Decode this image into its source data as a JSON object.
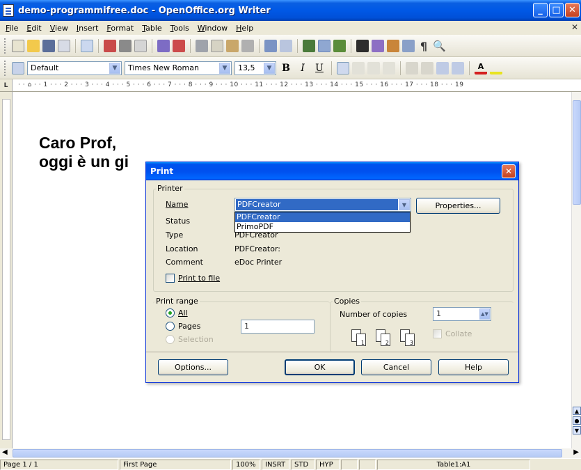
{
  "window": {
    "title": "demo-programmifree.doc - OpenOffice.org Writer"
  },
  "menu": [
    "File",
    "Edit",
    "View",
    "Insert",
    "Format",
    "Table",
    "Tools",
    "Window",
    "Help"
  ],
  "format_toolbar": {
    "style": "Default",
    "font": "Times New Roman",
    "size": "13,5"
  },
  "ruler": {
    "marks": "· · ⌂ · · 1 · · · 2 · · · 3 · · · 4 · · · 5 · · · 6 · · · 7 · · · 8 · · · 9 · · · 10 · · · 11 · · · 12 · · · 13 · · · 14 · · · 15 · · · 16 · · · 17 · · · 18 · · · 19"
  },
  "document": {
    "line1": "Caro Prof,",
    "line2": "oggi è un gi"
  },
  "print_dialog": {
    "title": "Print",
    "printer_group": "Printer",
    "name_label": "Name",
    "status_label": "Status",
    "type_label": "Type",
    "location_label": "Location",
    "comment_label": "Comment",
    "printer_name": "PDFCreator",
    "type_value": "PDFCreator",
    "location_value": "PDFCreator:",
    "comment_value": "eDoc Printer",
    "properties_button": "Properties...",
    "dropdown_options": [
      "PDFCreator",
      "PrimoPDF"
    ],
    "print_to_file": "Print to file",
    "range_group": "Print range",
    "all_label": "All",
    "pages_label": "Pages",
    "pages_value": "1",
    "selection_label": "Selection",
    "copies_group": "Copies",
    "copies_label": "Number of copies",
    "copies_value": "1",
    "collate_label": "Collate",
    "page_icons": [
      "1",
      "2",
      "3"
    ],
    "options_button": "Options...",
    "ok_button": "OK",
    "cancel_button": "Cancel",
    "help_button": "Help"
  },
  "status_bar": {
    "page": "Page 1 / 1",
    "style": "First Page",
    "zoom": "100%",
    "mode": "INSRT",
    "selection": "STD",
    "hyp": "HYP",
    "cell": "Table1:A1"
  },
  "colors": {
    "titlebar": "#0058e6",
    "selection": "#316ac5",
    "dialog_bg": "#ece9d8"
  }
}
